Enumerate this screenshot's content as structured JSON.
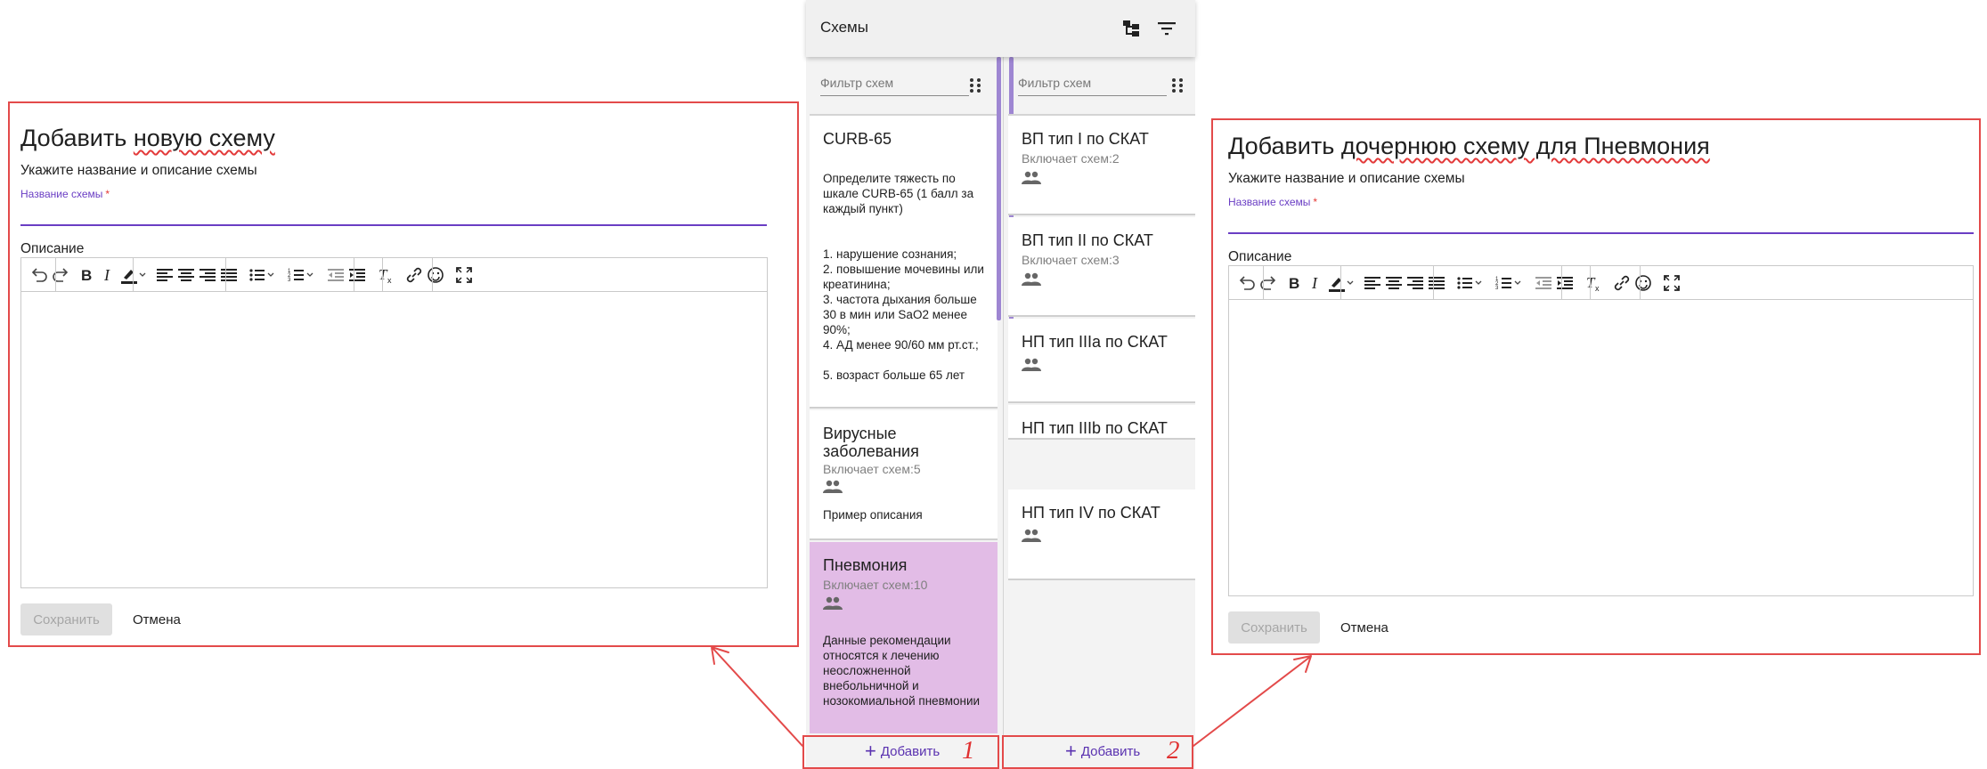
{
  "app": {
    "title": "Схемы",
    "columns": [
      {
        "filter_placeholder": "Фильтр схем",
        "add_label": "Добавить",
        "cards": [
          {
            "title": "CURB-65",
            "count": "",
            "description_lines": [
              "Определите тяжесть по шкале CURB-65 (1 балл за каждый пункт)",
              "",
              "1. нарушение сознания;",
              "2. повышение мочевины или креатинина;",
              "3. частота дыхания больше 30 в мин или SaO2 менее 90%;",
              "4. АД менее 90/60 мм рт.ст.;",
              "5. возраст больше 65 лет"
            ]
          },
          {
            "title": "Вирусные заболевания",
            "count": "Включает схем:5",
            "description": "Пример описания"
          },
          {
            "title": "Пневмония",
            "count": "Включает схем:10",
            "description": "Данные рекомендации относятся к лечению неосложненной внебольничной и нозокомиальной пневмонии",
            "selected": true
          }
        ]
      },
      {
        "filter_placeholder": "Фильтр схем",
        "add_label": "Добавить",
        "cards": [
          {
            "title": "ВП тип I по СКАТ",
            "count": "Включает схем:2"
          },
          {
            "title": "ВП тип II по СКАТ",
            "count": "Включает схем:3"
          },
          {
            "title": "НП тип IIIa по СКАТ",
            "count": ""
          },
          {
            "title": "НП тип IIIb по СКАТ",
            "count": ""
          },
          {
            "title": "НП тип IV по СКАТ",
            "count": ""
          }
        ]
      }
    ]
  },
  "form_new": {
    "title_prefix": "Добавить ",
    "title_highlight": "новую схему",
    "subtitle": "Укажите название и описание схемы",
    "name_label": "Название схемы",
    "required_mark": "*",
    "name_value": "",
    "description_label": "Описание",
    "save_label": "Сохранить",
    "cancel_label": "Отмена"
  },
  "form_child": {
    "title_prefix": "Добавить ",
    "title_highlight": "дочернюю схему для Пневмония",
    "subtitle": "Укажите название и описание схемы",
    "name_label": "Название схемы",
    "required_mark": "*",
    "name_value": "",
    "description_label": "Описание",
    "save_label": "Сохранить",
    "cancel_label": "Отмена"
  },
  "annotations": {
    "step1": "1",
    "step2": "2",
    "highlight_color": "#e34a4a"
  },
  "colors": {
    "accent": "#6a3ec4",
    "selected_card": "#e2bce6",
    "add_text": "#5a32b0"
  }
}
